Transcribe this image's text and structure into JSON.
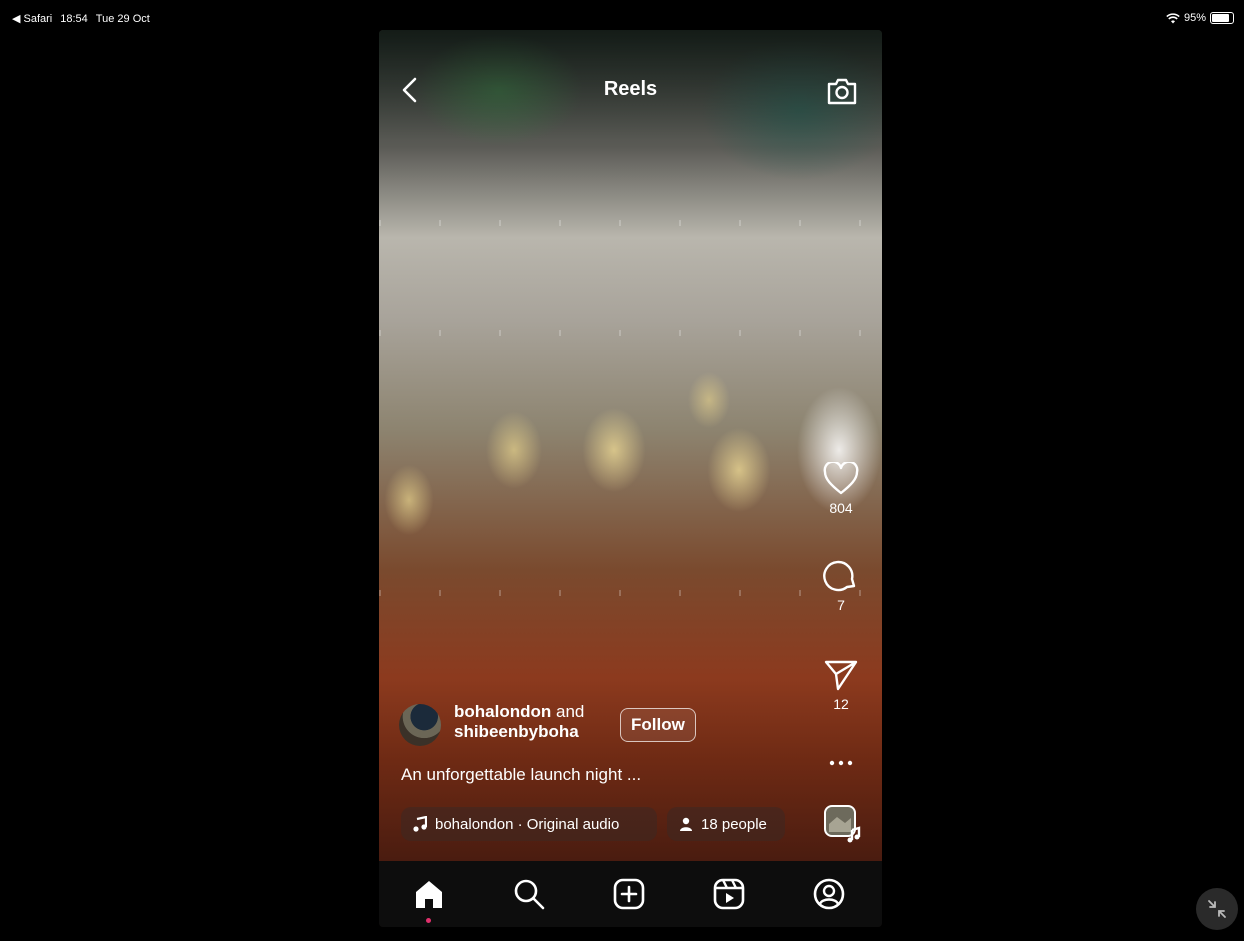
{
  "statusbar": {
    "back_app": "◀ Safari",
    "time": "18:54",
    "date": "Tue 29 Oct",
    "battery": "95%",
    "battery_level": 0.95
  },
  "header": {
    "title": "Reels"
  },
  "actions": {
    "likes": "804",
    "comments": "7",
    "shares": "12"
  },
  "post": {
    "user1": "bohalondon",
    "joiner": " and",
    "user2": "shibeenbyboha",
    "follow_label": "Follow",
    "caption": "An unforgettable launch night ...",
    "audio": "bohalondon · Original audio",
    "people": "18 people"
  },
  "tabbar": {
    "active": "home",
    "indicator_color": "#e1306c"
  },
  "colors": {
    "background": "#000000",
    "tabbar": "#0d0d0d"
  }
}
